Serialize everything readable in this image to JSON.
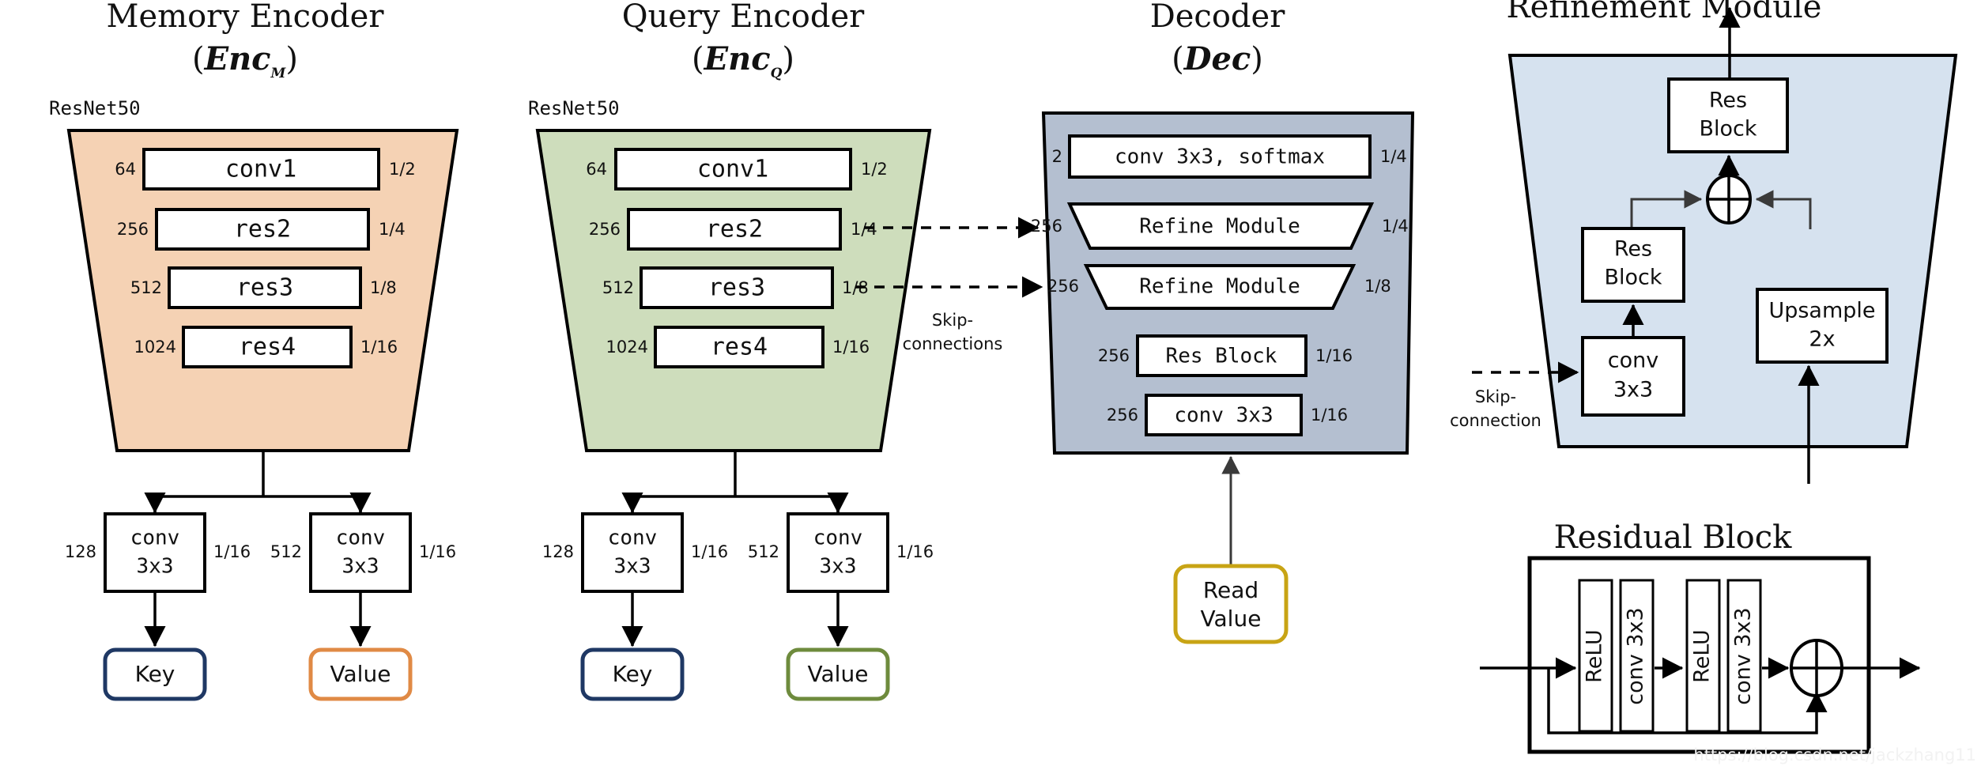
{
  "figure": {
    "watermark": "https://blog.csdn.net/jackzhang11"
  },
  "colors": {
    "memory_fill": "#F5D2B4",
    "query_fill": "#CEDDBC",
    "decoder_fill": "#B4BFD0",
    "refine_fill": "#D6E2EF",
    "key_border": "#1F3864",
    "value_memory_border": "#E08A45",
    "value_query_border": "#6E8B3D",
    "read_value_border": "#C8A415",
    "stroke": "#000000"
  },
  "memory_encoder": {
    "title_line1": "Memory Encoder",
    "title_name": "Enc",
    "title_sub": "M",
    "paren_open": "(",
    "paren_close": ")",
    "backbone": "ResNet50",
    "stages": [
      {
        "label": "conv1",
        "channels": "64",
        "scale": "1/2"
      },
      {
        "label": "res2",
        "channels": "256",
        "scale": "1/4"
      },
      {
        "label": "res3",
        "channels": "512",
        "scale": "1/8"
      },
      {
        "label": "res4",
        "channels": "1024",
        "scale": "1/16"
      }
    ],
    "heads": [
      {
        "conv_line1": "conv",
        "conv_line2": "3x3",
        "channels": "128",
        "scale": "1/16",
        "out": "Key",
        "out_color": "#1F3864"
      },
      {
        "conv_line1": "conv",
        "conv_line2": "3x3",
        "channels": "512",
        "scale": "1/16",
        "out": "Value",
        "out_color": "#E08A45"
      }
    ]
  },
  "query_encoder": {
    "title_line1": "Query Encoder",
    "title_name": "Enc",
    "title_sub": "Q",
    "paren_open": "(",
    "paren_close": ")",
    "backbone": "ResNet50",
    "stages": [
      {
        "label": "conv1",
        "channels": "64",
        "scale": "1/2"
      },
      {
        "label": "res2",
        "channels": "256",
        "scale": "1/4"
      },
      {
        "label": "res3",
        "channels": "512",
        "scale": "1/8"
      },
      {
        "label": "res4",
        "channels": "1024",
        "scale": "1/16"
      }
    ],
    "heads": [
      {
        "conv_line1": "conv",
        "conv_line2": "3x3",
        "channels": "128",
        "scale": "1/16",
        "out": "Key",
        "out_color": "#1F3864"
      },
      {
        "conv_line1": "conv",
        "conv_line2": "3x3",
        "channels": "512",
        "scale": "1/16",
        "out": "Value",
        "out_color": "#6E8B3D"
      }
    ]
  },
  "skip": {
    "label_line1": "Skip-",
    "label_line2": "connections"
  },
  "decoder": {
    "title_line1": "Decoder",
    "title_name": "Dec",
    "paren_open": "(",
    "paren_close": ")",
    "stages": [
      {
        "label": "conv 3x3, softmax",
        "channels": "2",
        "scale": "1/4",
        "shape": "rect"
      },
      {
        "label": "Refine Module",
        "channels": "256",
        "scale": "1/4",
        "shape": "trap"
      },
      {
        "label": "Refine Module",
        "channels": "256",
        "scale": "1/8",
        "shape": "trap"
      },
      {
        "label": "Res Block",
        "channels": "256",
        "scale": "1/16",
        "shape": "rect"
      },
      {
        "label": "conv 3x3",
        "channels": "256",
        "scale": "1/16",
        "shape": "rect"
      }
    ],
    "input": {
      "line1": "Read",
      "line2": "Value"
    }
  },
  "refinement_module": {
    "title": "Refinement Module",
    "blocks": {
      "res_block_top": {
        "line1": "Res",
        "line2": "Block"
      },
      "res_block_left": {
        "line1": "Res",
        "line2": "Block"
      },
      "conv": {
        "line1": "conv",
        "line2": "3x3"
      },
      "upsample": {
        "line1": "Upsample",
        "line2": "2x"
      }
    },
    "sum_symbol": "+",
    "skip_label_line1": "Skip-",
    "skip_label_line2": "connection"
  },
  "residual_block": {
    "title": "Residual Block",
    "layers": [
      "ReLU",
      "conv 3x3",
      "ReLU",
      "conv 3x3"
    ],
    "sum_symbol": "+"
  }
}
